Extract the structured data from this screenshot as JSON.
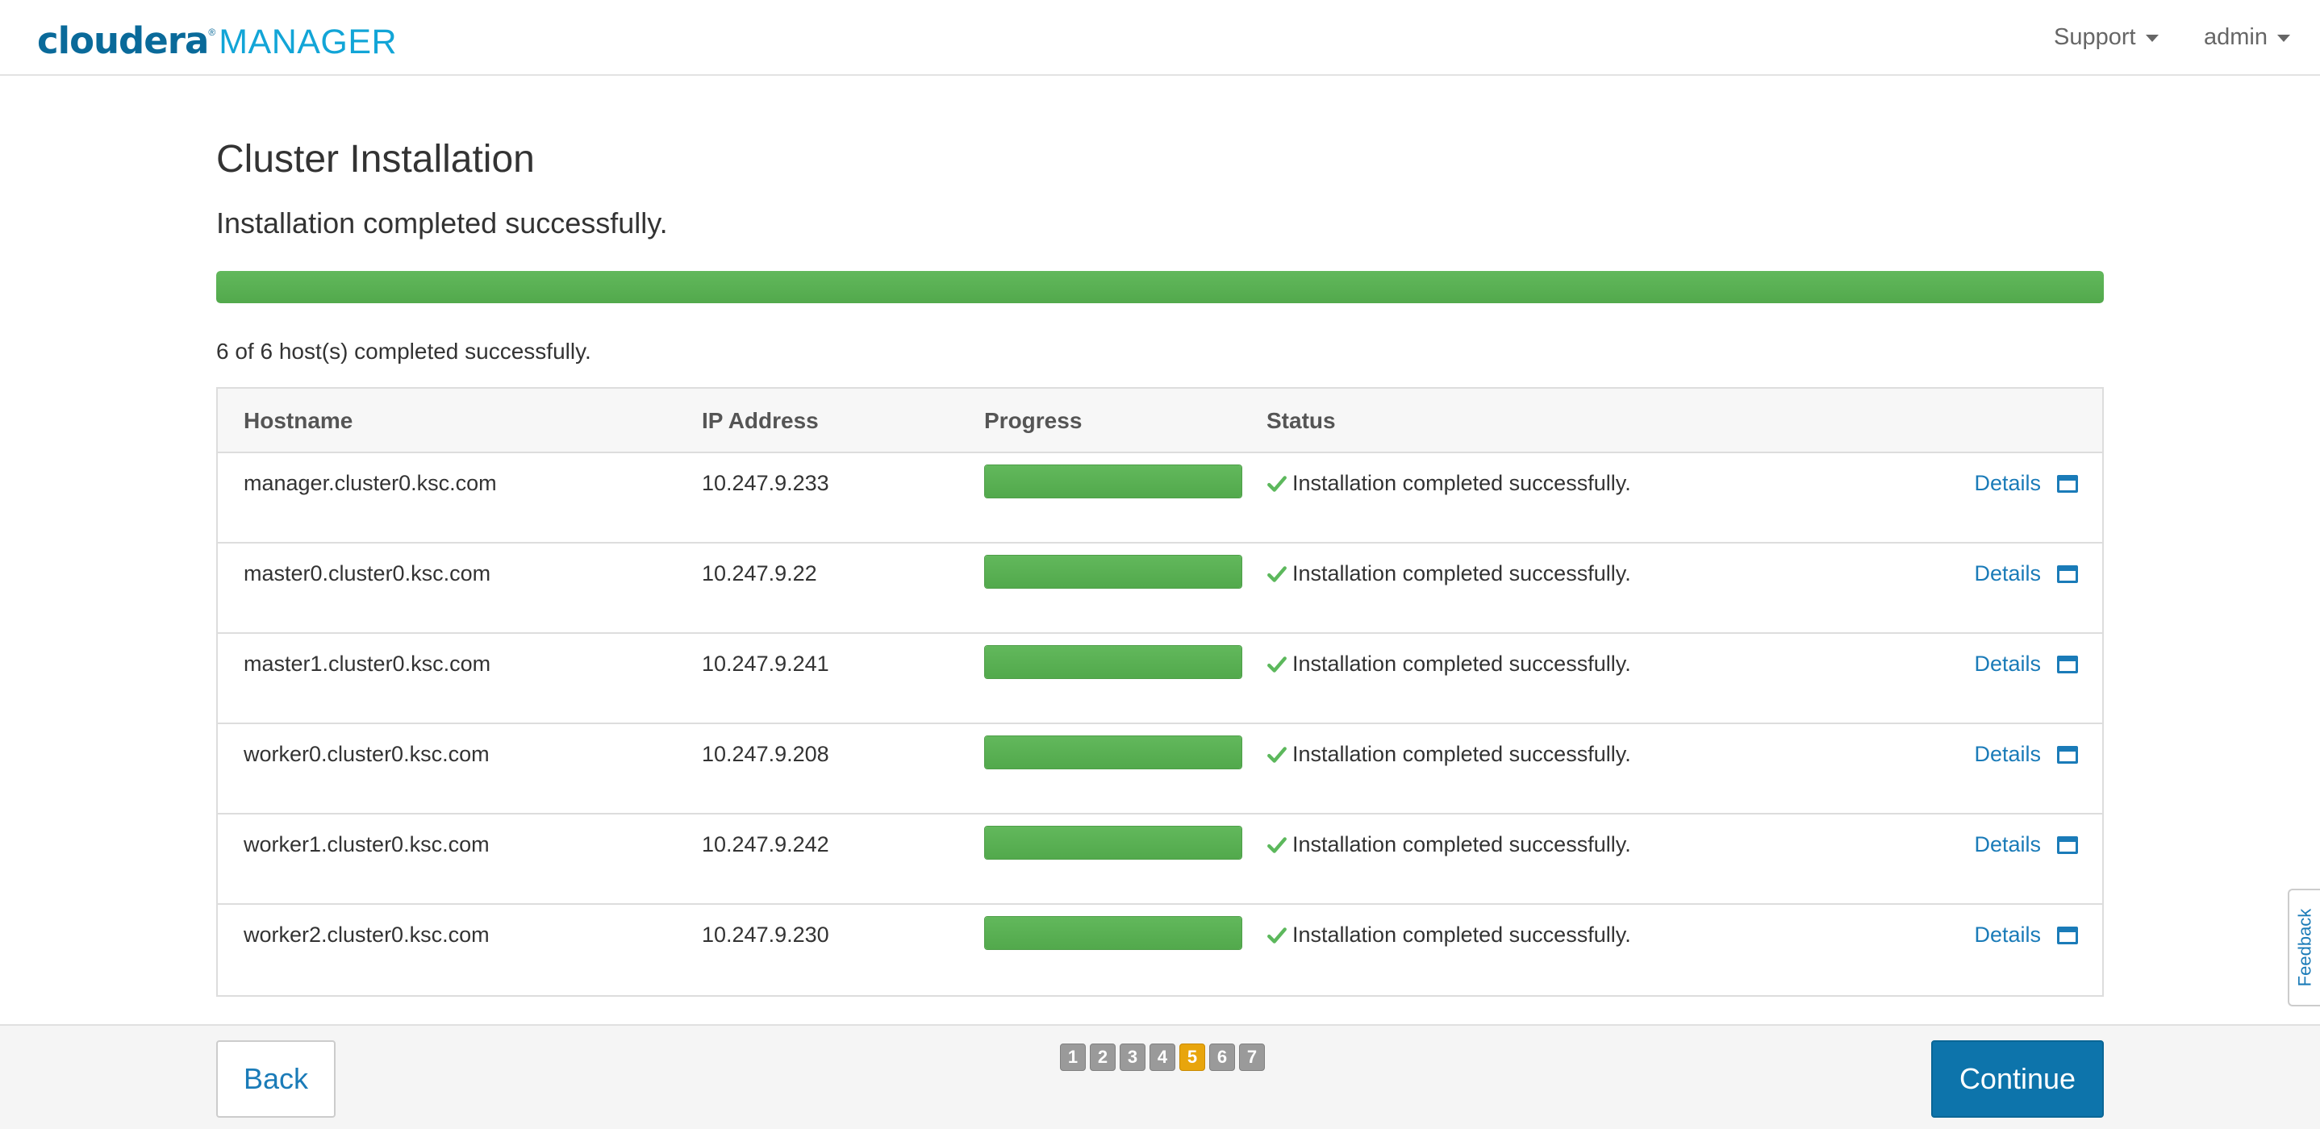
{
  "header": {
    "brand": "cloudera",
    "trademark": "®",
    "product": "MANAGER",
    "menus": [
      {
        "label": "Support"
      },
      {
        "label": "admin"
      }
    ]
  },
  "main": {
    "title": "Cluster Installation",
    "subtitle": "Installation completed successfully.",
    "overall_progress_percent": 100,
    "summary": "6 of 6 host(s) completed successfully."
  },
  "table": {
    "columns": [
      "Hostname",
      "IP Address",
      "Progress",
      "Status"
    ],
    "rows": [
      {
        "hostname": "manager.cluster0.ksc.com",
        "ip": "10.247.9.233",
        "progress_percent": 100,
        "status": "Installation completed successfully.",
        "details": "Details"
      },
      {
        "hostname": "master0.cluster0.ksc.com",
        "ip": "10.247.9.22",
        "progress_percent": 100,
        "status": "Installation completed successfully.",
        "details": "Details"
      },
      {
        "hostname": "master1.cluster0.ksc.com",
        "ip": "10.247.9.241",
        "progress_percent": 100,
        "status": "Installation completed successfully.",
        "details": "Details"
      },
      {
        "hostname": "worker0.cluster0.ksc.com",
        "ip": "10.247.9.208",
        "progress_percent": 100,
        "status": "Installation completed successfully.",
        "details": "Details"
      },
      {
        "hostname": "worker1.cluster0.ksc.com",
        "ip": "10.247.9.242",
        "progress_percent": 100,
        "status": "Installation completed successfully.",
        "details": "Details"
      },
      {
        "hostname": "worker2.cluster0.ksc.com",
        "ip": "10.247.9.230",
        "progress_percent": 100,
        "status": "Installation completed successfully.",
        "details": "Details"
      }
    ]
  },
  "footer": {
    "back_label": "Back",
    "continue_label": "Continue",
    "steps": [
      "1",
      "2",
      "3",
      "4",
      "5",
      "6",
      "7"
    ],
    "active_step": "5"
  },
  "feedback_label": "Feedback",
  "colors": {
    "accent": "#0d74ab",
    "success": "#5cb85c",
    "active_step": "#e8a50c",
    "link": "#1a7bb8"
  }
}
